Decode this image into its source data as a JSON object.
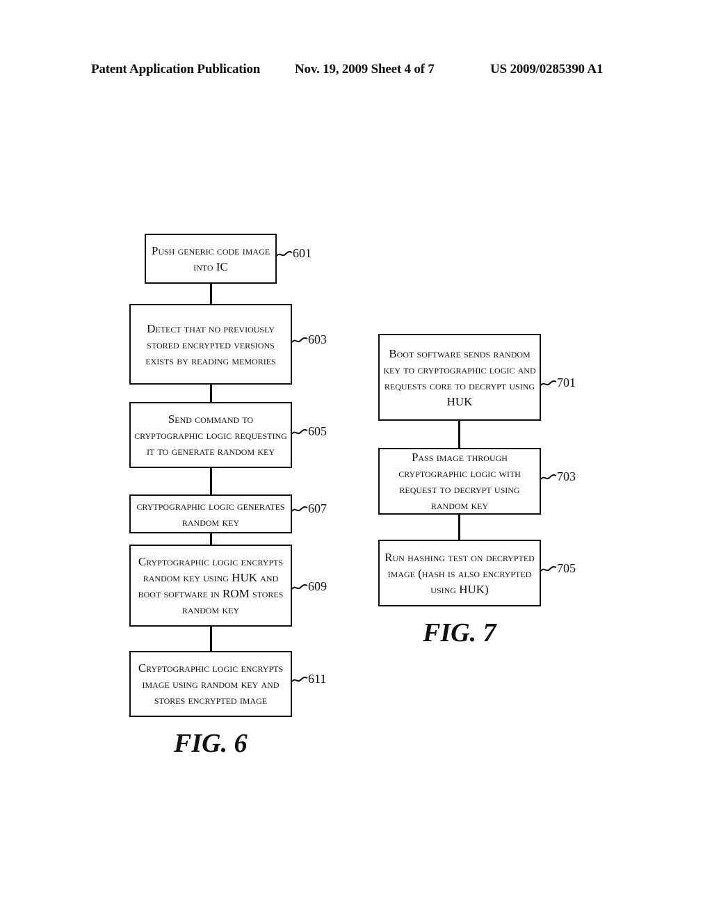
{
  "header": {
    "left": "Patent Application Publication",
    "date_sheet": "Nov. 19, 2009   Sheet 4 of 7",
    "pub_number": "US 2009/0285390 A1"
  },
  "fig6": {
    "label": "FIG. 6",
    "steps": [
      {
        "ref": "601",
        "text": "Push generic code image into IC"
      },
      {
        "ref": "603",
        "text": "Detect that no previously stored encrypted versions exists by reading memories"
      },
      {
        "ref": "605",
        "text": "Send command to cryptographic logic requesting it to generate random key"
      },
      {
        "ref": "607",
        "text": "crytpographic logic generates random key"
      },
      {
        "ref": "609",
        "text": "Cryptographic logic encrypts random key using HUK and boot software in ROM stores random key"
      },
      {
        "ref": "611",
        "text": "Cryptographic logic encrypts image using random key and stores encrypted image"
      }
    ]
  },
  "fig7": {
    "label": "FIG. 7",
    "steps": [
      {
        "ref": "701",
        "text": "Boot software sends random key to cryptographic logic and requests core to decrypt using HUK"
      },
      {
        "ref": "703",
        "text": "Pass image through cryptographic logic with request to decrypt using random key"
      },
      {
        "ref": "705",
        "text": "Run hashing test on decrypted image (hash is also encrypted using HUK)"
      }
    ]
  }
}
